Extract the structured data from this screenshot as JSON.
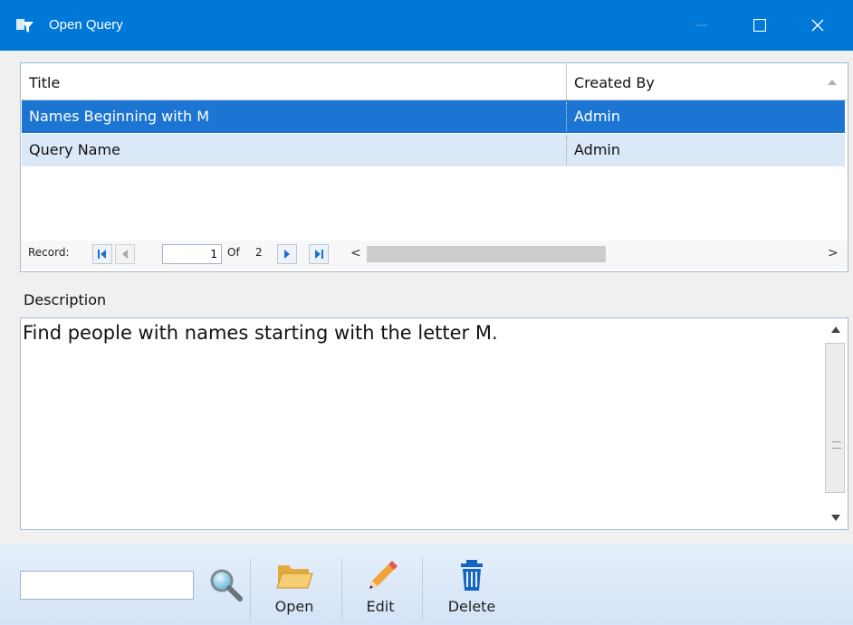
{
  "window": {
    "title": "Open Query"
  },
  "grid": {
    "columns": [
      "Title",
      "Created By"
    ],
    "rows": [
      {
        "title": "Names Beginning with M",
        "created_by": "Admin",
        "selected": true
      },
      {
        "title": "Query Name",
        "created_by": "Admin",
        "selected": false
      }
    ]
  },
  "navigator": {
    "label": "Record:",
    "current": "1",
    "of_label": "Of",
    "total": "2"
  },
  "description": {
    "label": "Description",
    "text": "Find people with names starting with the letter M."
  },
  "toolbar": {
    "search_value": "",
    "open_label": "Open",
    "edit_label": "Edit",
    "delete_label": "Delete"
  },
  "colors": {
    "titlebar": "#0078d7",
    "selected_row": "#1c75d2",
    "alt_row": "#dbe8f8",
    "folder": "#f0c36a",
    "delete_icon": "#1565c0"
  },
  "icons": [
    "app-icon",
    "minimize-icon",
    "maximize-icon",
    "close-icon",
    "first-record-icon",
    "prev-record-icon",
    "next-record-icon",
    "last-record-icon",
    "search-icon",
    "folder-open-icon",
    "pencil-icon",
    "trash-icon"
  ]
}
